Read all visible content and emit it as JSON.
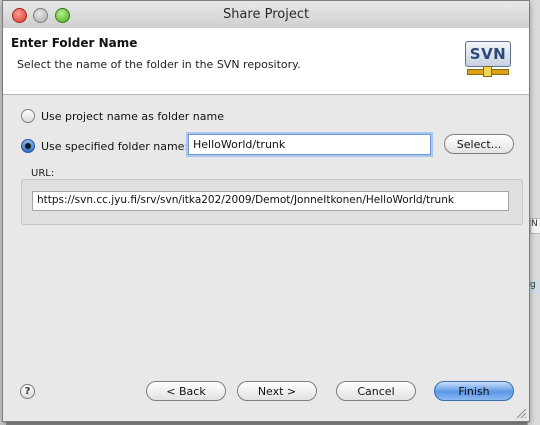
{
  "window": {
    "title": "Share Project"
  },
  "header": {
    "title": "Enter Folder Name",
    "description": "Select the name of the folder in the SVN repository.",
    "logo_text": "SVN"
  },
  "options": {
    "project_name": {
      "label": "Use project name as folder name",
      "selected": false
    },
    "specified_name": {
      "label": "Use specified folder name:",
      "selected": true
    }
  },
  "folder_name": {
    "value": "HelloWorld/trunk"
  },
  "select_button": {
    "label": "Select..."
  },
  "url": {
    "label": "URL:",
    "value": "https://svn.cc.jyu.fi/srv/svn/itka202/2009/Demot/JonneItkonen/HelloWorld/trunk"
  },
  "help": {
    "icon": "question-mark",
    "label": "?"
  },
  "buttons": {
    "back": "< Back",
    "next": "Next >",
    "cancel": "Cancel",
    "finish": "Finish"
  },
  "background": {
    "frag1": "N",
    "frag2": "g"
  }
}
